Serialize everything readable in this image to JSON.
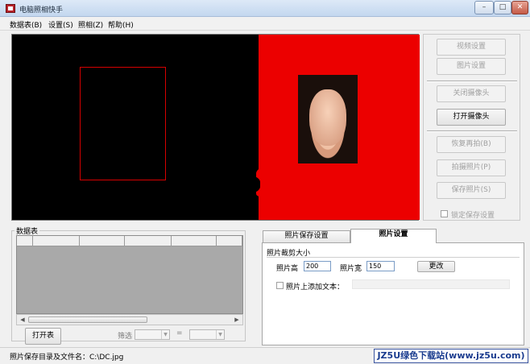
{
  "window": {
    "title": "电脑照相快手",
    "min_glyph": "–",
    "max_glyph": "□",
    "close_glyph": "✕"
  },
  "menu": [
    "数据表(B)",
    "设置(S)",
    "照相(Z)",
    "帮助(H)"
  ],
  "right_panel": {
    "buttons": [
      {
        "label": "视频设置",
        "enabled": false
      },
      {
        "label": "图片设置",
        "enabled": false
      },
      {
        "label": "关闭摄像头",
        "enabled": false
      },
      {
        "label": "打开摄像头",
        "enabled": true
      },
      {
        "label": "恢复再拍(B)",
        "enabled": false
      },
      {
        "label": "拍摄照片(P)",
        "enabled": false
      },
      {
        "label": "保存照片(S)",
        "enabled": false
      }
    ],
    "lock_label": "锁定保存设置",
    "lock_checked": false
  },
  "data_table": {
    "group_label": "数据表",
    "open_button": "打开表",
    "filter_label": "筛选",
    "equals": "=",
    "filter_field": "",
    "filter_value": ""
  },
  "tabs": [
    {
      "label": "照片保存设置",
      "active": false
    },
    {
      "label": "照片设置",
      "active": true
    }
  ],
  "photo_settings": {
    "crop_title": "照片裁剪大小",
    "height_label": "照片高",
    "height_value": "200",
    "width_label": "照片宽",
    "width_value": "150",
    "change_button": "更改",
    "add_text_label": "照片上添加文本：",
    "add_text_checked": false,
    "add_text_value": ""
  },
  "status": {
    "text": "照片保存目录及文件名：C:\\DC.jpg",
    "watermark": "JZ5U绿色下载站(www.jz5u.com)"
  },
  "icons": {
    "scroll_left": "scroll-left-icon",
    "scroll_right": "scroll-right-icon",
    "combo_arrow": "chevron-down-icon"
  },
  "colors": {
    "preview_background": "#000000",
    "preview_overlay": "#ec0000",
    "crop_frame": "#d60000",
    "watermark_text": "#1a3c8f"
  }
}
